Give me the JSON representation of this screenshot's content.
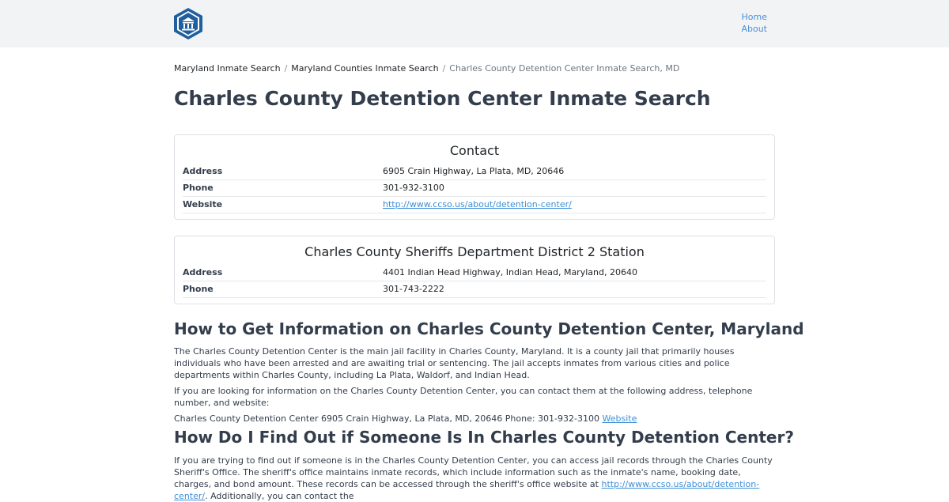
{
  "header": {
    "logo_name": "inmate-search-logo",
    "nav": [
      {
        "label": "Home"
      },
      {
        "label": "About"
      }
    ]
  },
  "breadcrumb": {
    "items": [
      "Maryland Inmate Search",
      "Maryland Counties Inmate Search"
    ],
    "current": "Charles County Detention Center Inmate Search, MD"
  },
  "page_title": "Charles County Detention Center Inmate Search",
  "contact_card": {
    "title": "Contact",
    "rows": [
      {
        "label": "Address",
        "value": "6905 Crain Highway, La Plata, MD, 20646"
      },
      {
        "label": "Phone",
        "value": "301-932-3100"
      },
      {
        "label": "Website",
        "value": "http://www.ccso.us/about/detention-center/"
      }
    ]
  },
  "station_card": {
    "title": "Charles County Sheriffs Department District 2 Station",
    "rows": [
      {
        "label": "Address",
        "value": "4401 Indian Head Highway, Indian Head, Maryland, 20640"
      },
      {
        "label": "Phone",
        "value": "301-743-2222"
      }
    ]
  },
  "section1": {
    "heading": "How to Get Information on Charles County Detention Center, Maryland",
    "para1": "The Charles County Detention Center is the main jail facility in Charles County, Maryland. It is a county jail that primarily houses individuals who have been arrested and are awaiting trial or sentencing. The jail accepts inmates from various cities and police departments within Charles County, including La Plata, Waldorf, and Indian Head.",
    "para2": "If you are looking for information on the Charles County Detention Center, you can contact them at the following address, telephone number, and website:",
    "contact_line": "Charles County Detention Center 6905 Crain Highway, La Plata, MD, 20646 Phone: 301-932-3100",
    "website_link": "Website"
  },
  "section2": {
    "heading": "How Do I Find Out if Someone Is In Charles County Detention Center?",
    "para_text": "If you are trying to find out if someone is in the Charles County Detention Center, you can access jail records through the Charles County Sheriff's Office. The sheriff's office maintains inmate records, which include information such as the inmate's name, booking date, charges, and bond amount. These records can be accessed through the sheriff's office website at",
    "para_link": "http://www.ccso.us/about/detention-center/",
    "para_after": ". Additionally, you can contact the"
  },
  "colors": {
    "topbar": "#f2f3f5",
    "link": "#3d8fd6",
    "heading": "#333d4b",
    "logo": "#1f5f9e"
  }
}
